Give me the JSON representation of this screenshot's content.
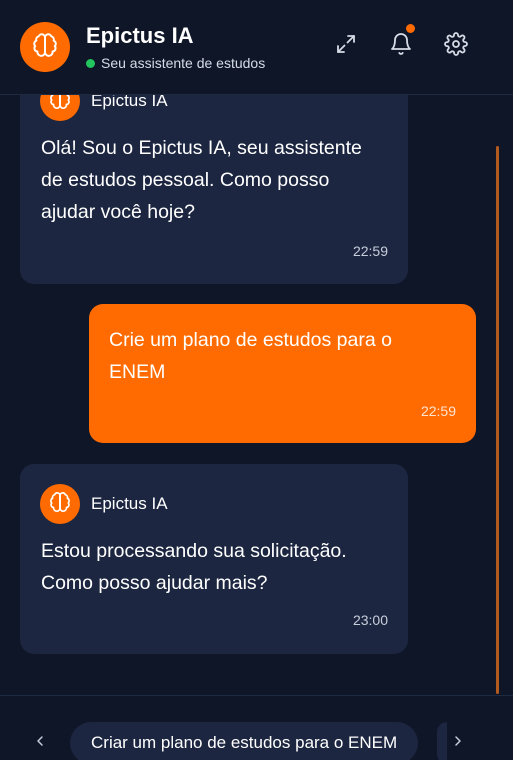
{
  "header": {
    "title": "Epictus IA",
    "status": "Seu assistente de estudos",
    "icons": {
      "logo": "brain-icon",
      "expand": "expand-icon",
      "notifications": "bell-icon",
      "settings": "gear-icon"
    }
  },
  "colors": {
    "accent": "#ff6b00",
    "background": "#0e1628",
    "bot_bubble": "#1c2640",
    "online": "#22c55e"
  },
  "messages": [
    {
      "role": "bot",
      "name": "Epictus IA",
      "text_lines": [
        "Olá! Sou o Epictus IA, seu assistente",
        "de estudos pessoal. Como posso",
        "ajudar você hoje?"
      ],
      "time": "22:59"
    },
    {
      "role": "user",
      "text_lines": [
        "Crie um plano de estudos para o",
        "ENEM"
      ],
      "time": "22:59"
    },
    {
      "role": "bot",
      "name": "Epictus IA",
      "text_lines": [
        "Estou processando sua solicitação.",
        "Como posso ajudar mais?"
      ],
      "time": "23:00"
    }
  ],
  "suggestions": {
    "items": [
      "Criar um plano de estudos para o ENEM"
    ]
  }
}
